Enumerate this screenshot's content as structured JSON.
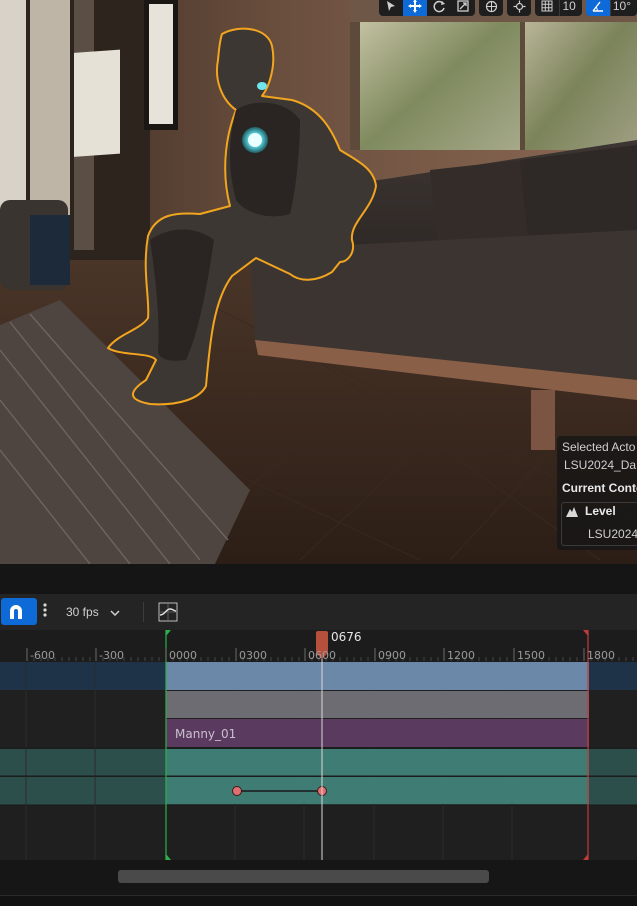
{
  "viewport": {
    "toolbar": {
      "grid_snap_value": "10",
      "rotation_snap_value": "10°"
    },
    "details_overlay": {
      "selected_actor_label": "Selected Acto",
      "selected_actor_value": "LSU2024_Da",
      "current_context_label": "Current Conte",
      "level_label": "Level",
      "level_value": "LSU2024"
    }
  },
  "sequencer": {
    "frame_rate": "30 fps",
    "playhead_frame": "0676",
    "ruler_ticks": [
      "-600",
      "-300",
      "0000",
      "0300",
      "0600",
      "0900",
      "1200",
      "1500",
      "1800"
    ],
    "tracks": {
      "skeletal_section_label": "Manny_01"
    },
    "colors": {
      "snap_accent": "#0e6ad6",
      "camera_cut_section": "#6b88a8",
      "shot_section": "#6d6c73",
      "skeletal_section": "#5a3a5e",
      "transform_section": "#3f7c74",
      "keyframe": "#e07070",
      "start_marker": "#2db04a",
      "end_marker": "#c23b3b",
      "selection_outline": "#f2a51e"
    }
  }
}
